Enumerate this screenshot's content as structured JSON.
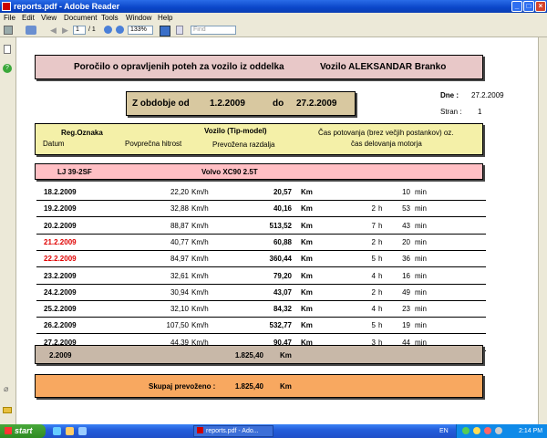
{
  "window": {
    "title": "reports.pdf - Adobe Reader"
  },
  "menu": [
    "File",
    "Edit",
    "View",
    "Document",
    "Tools",
    "Window",
    "Help"
  ],
  "toolbar": {
    "page_current": "1",
    "page_total": "/ 1",
    "zoom": "133%",
    "find_placeholder": "Find"
  },
  "report": {
    "header_title": "Poročilo o opravljenih poteh za vozilo iz oddelka",
    "header_vehicle": "Vozilo ALEKSANDAR Branko",
    "period_from_label": "Z obdobje od",
    "period_from": "1.2.2009",
    "period_to_label": "do",
    "period_to": "27.2.2009",
    "date_label": "Dne :",
    "date_value": "27.2.2009",
    "page_label": "Stran :",
    "page_value": "1",
    "columns": {
      "reg": "Reg.Oznaka",
      "vehicle": "Vozilo (Tip-model)",
      "time": "Čas potovanja (brez večjih postankov) oz.",
      "date": "Datum",
      "speed": "Povprečna hitrost",
      "distance": "Prevožena razdalja",
      "engine": "čas delovanja motorja"
    },
    "vehicle_reg": "LJ 39-2SF",
    "vehicle_model": "Volvo XC90 2.5T",
    "rows": [
      {
        "date": "18.2.2009",
        "speed": "22,20",
        "speed_unit": "Km/h",
        "dist": "20,57",
        "dist_unit": "Km",
        "h": "",
        "h_unit": "",
        "m": "10",
        "m_unit": "min"
      },
      {
        "date": "19.2.2009",
        "speed": "32,88",
        "speed_unit": "Km/h",
        "dist": "40,16",
        "dist_unit": "Km",
        "h": "2",
        "h_unit": "h",
        "m": "53",
        "m_unit": "min"
      },
      {
        "date": "20.2.2009",
        "speed": "88,87",
        "speed_unit": "Km/h",
        "dist": "513,52",
        "dist_unit": "Km",
        "h": "7",
        "h_unit": "h",
        "m": "43",
        "m_unit": "min"
      },
      {
        "date": "21.2.2009",
        "speed": "40,77",
        "speed_unit": "Km/h",
        "dist": "60,88",
        "dist_unit": "Km",
        "h": "2",
        "h_unit": "h",
        "m": "20",
        "m_unit": "min"
      },
      {
        "date": "22.2.2009",
        "speed": "84,97",
        "speed_unit": "Km/h",
        "dist": "360,44",
        "dist_unit": "Km",
        "h": "5",
        "h_unit": "h",
        "m": "36",
        "m_unit": "min"
      },
      {
        "date": "23.2.2009",
        "speed": "32,61",
        "speed_unit": "Km/h",
        "dist": "79,20",
        "dist_unit": "Km",
        "h": "4",
        "h_unit": "h",
        "m": "16",
        "m_unit": "min"
      },
      {
        "date": "24.2.2009",
        "speed": "30,94",
        "speed_unit": "Km/h",
        "dist": "43,07",
        "dist_unit": "Km",
        "h": "2",
        "h_unit": "h",
        "m": "49",
        "m_unit": "min"
      },
      {
        "date": "25.2.2009",
        "speed": "32,10",
        "speed_unit": "Km/h",
        "dist": "84,32",
        "dist_unit": "Km",
        "h": "4",
        "h_unit": "h",
        "m": "23",
        "m_unit": "min"
      },
      {
        "date": "26.2.2009",
        "speed": "107,50",
        "speed_unit": "Km/h",
        "dist": "532,77",
        "dist_unit": "Km",
        "h": "5",
        "h_unit": "h",
        "m": "19",
        "m_unit": "min"
      },
      {
        "date": "27.2.2009",
        "speed": "44,39",
        "speed_unit": "Km/h",
        "dist": "90,47",
        "dist_unit": "Km",
        "h": "3",
        "h_unit": "h",
        "m": "44",
        "m_unit": "min"
      }
    ],
    "subtotal_label": "2.2009",
    "subtotal_dist": "1.825,40",
    "subtotal_unit": "Km",
    "total_label": "Skupaj prevoženo :",
    "total_dist": "1.825,40",
    "total_unit": "Km"
  },
  "colors": {
    "header_pink": "#e8c8c8",
    "period_tan": "#d8c8a0",
    "columns_yellow": "#f4f0a8",
    "vehicle_pink": "#ffbfc4",
    "subtotal_tan": "#c8b8a8",
    "total_orange": "#f8a860",
    "weekend_red": "#e00000"
  },
  "taskbar": {
    "start": "start",
    "task": "reports.pdf - Ado...",
    "lang": "EN",
    "clock": "2:14 PM"
  }
}
